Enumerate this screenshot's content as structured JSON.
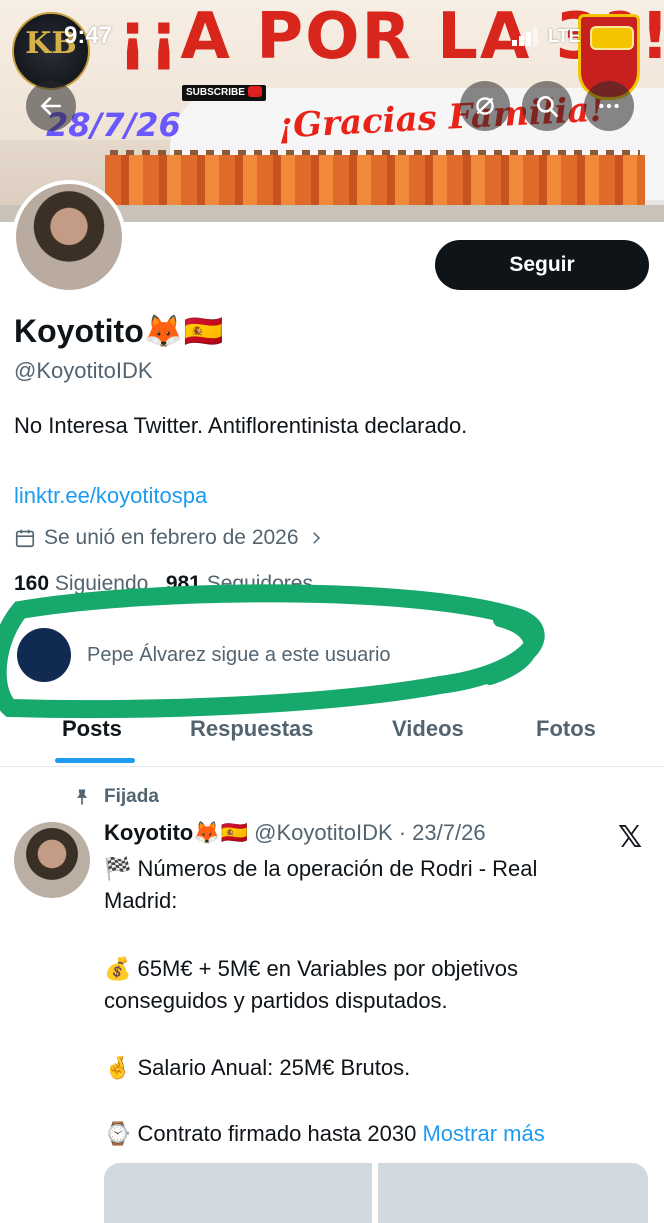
{
  "status": {
    "time": "9:47",
    "carrier": "LTE"
  },
  "banner": {
    "title": "¡¡A POR LA 3ª!!",
    "subtitle": "¡Gracias Familia!",
    "date": "28/7/26",
    "subscribe": "SUBSCRIBE",
    "logo": "KB"
  },
  "profile": {
    "name": "Koyotito🦊🇪🇸",
    "handle": "@KoyotitoIDK",
    "bio": "No Interesa Twitter. Antiflorentinista declarado.",
    "link": "linktr.ee/koyotitospa",
    "joined": "Se unió en febrero de 2026",
    "following_count": "160",
    "following_label": "Siguiendo",
    "followers_count": "981",
    "followers_label": "Seguidores",
    "follow_button": "Seguir"
  },
  "followed_by": "Pepe Álvarez sigue a este usuario",
  "tabs": [
    "Posts",
    "Respuestas",
    "Videos",
    "Fotos"
  ],
  "pinned_post": {
    "pinned_label": "Fijada",
    "author_name": "Koyotito🦊🇪🇸",
    "meta": "@KoyotitoIDK · 23/7/26",
    "lines": [
      "🏁 Números de la operación de Rodri - Real",
      "Madrid:",
      "💰 65M€ + 5M€ en Variables por objetivos",
      "conseguidos y partidos disputados.",
      "🤞 Salario Anual: 25M€ Brutos.",
      "⌚ Contrato firmado hasta 2030"
    ],
    "show_more": "Mostrar más"
  },
  "colors": {
    "accent": "#1d9bf0",
    "marker": "#17a86b",
    "text": "#0f1419",
    "secondary": "#536471"
  }
}
